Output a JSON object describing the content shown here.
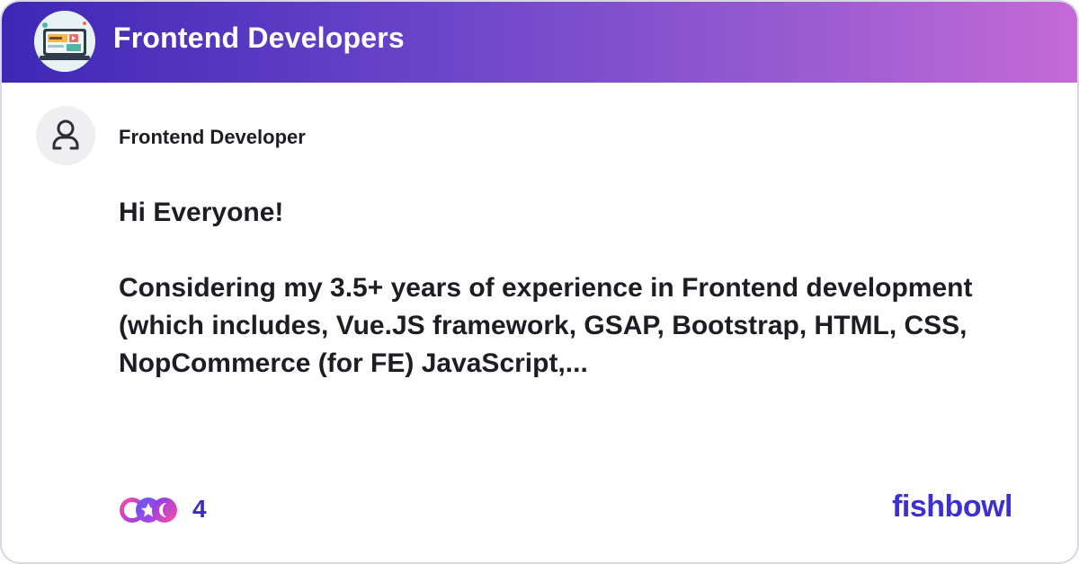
{
  "header": {
    "group_title": "Frontend Developers",
    "logo_icon": "code-editor-illustration-icon",
    "gradient": [
      "#3f27b6",
      "#c56ad6"
    ]
  },
  "post": {
    "author": "Frontend Developer",
    "avatar_icon": "user-icon",
    "greeting": "Hi Everyone!",
    "body": "Considering my 3.5+ years of experience in Frontend development (which includes, Vue.JS framework, GSAP, Bootstrap, HTML, CSS, NopCommerce (for FE) JavaScript,..."
  },
  "footer": {
    "reaction_icons": [
      "reaction-icon",
      "star-reaction-icon",
      "moon-reaction-icon"
    ],
    "reaction_count": "4",
    "brand": "fishbowl",
    "brand_color": "#3c2fd4"
  }
}
